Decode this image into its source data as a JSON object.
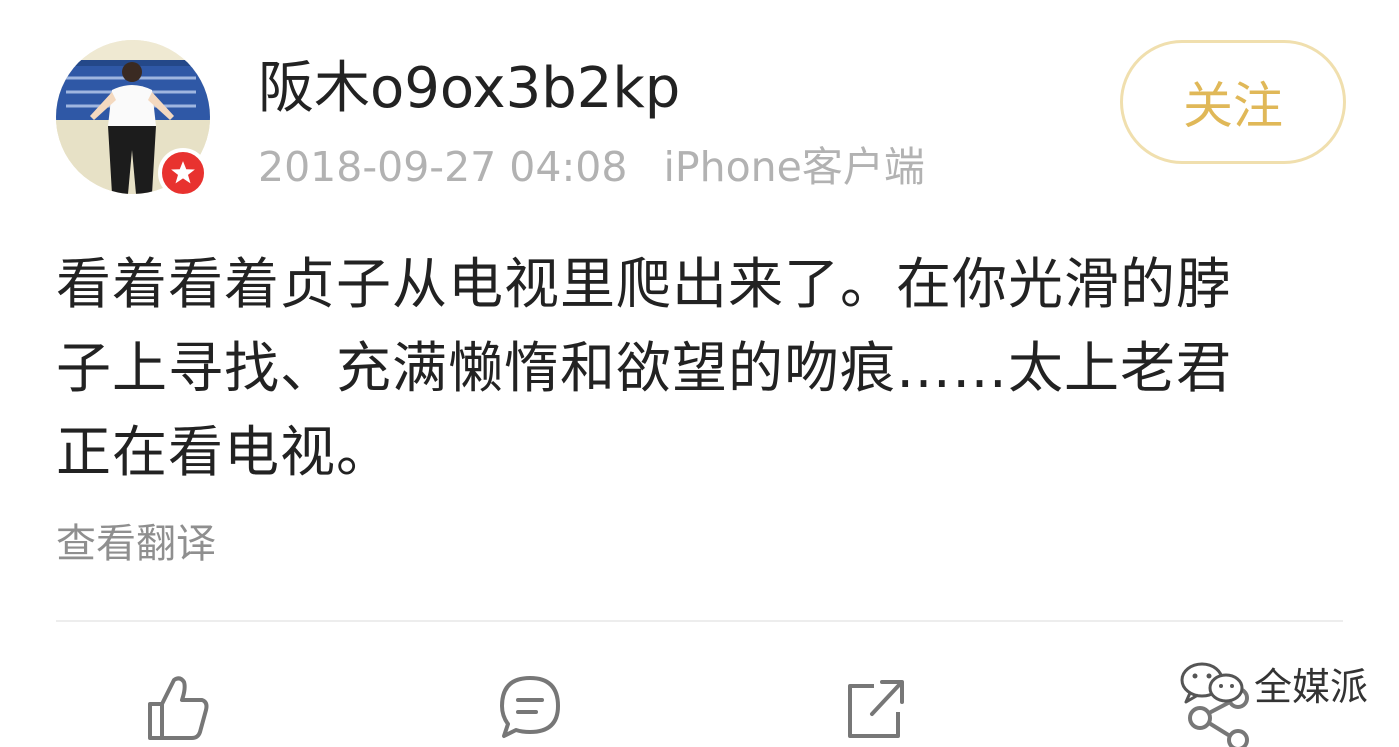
{
  "post": {
    "username": "阪木o9ox3b2kp",
    "timestamp": "2018-09-27 04:08",
    "device": "iPhone客户端",
    "follow_label": "关注",
    "content_lines": [
      "看着看着贞子从电视里爬出来了。在你光滑的脖",
      "子上寻找、充满懒惰和欲望的吻痕……太上老君",
      "正在看电视。"
    ],
    "translate_label": "查看翻译"
  },
  "actions": [
    {
      "name": "like",
      "icon": "thumbs-up-icon"
    },
    {
      "name": "comment",
      "icon": "comment-icon"
    },
    {
      "name": "repost",
      "icon": "repost-icon"
    },
    {
      "name": "share",
      "icon": "share-icon"
    }
  ],
  "watermark": {
    "text": "全媒派",
    "icon": "wechat-icon"
  },
  "colors": {
    "accent_gold": "#e0b858",
    "badge_red": "#e8322f",
    "muted_text": "#b2b2b2",
    "body_text": "#222222"
  }
}
